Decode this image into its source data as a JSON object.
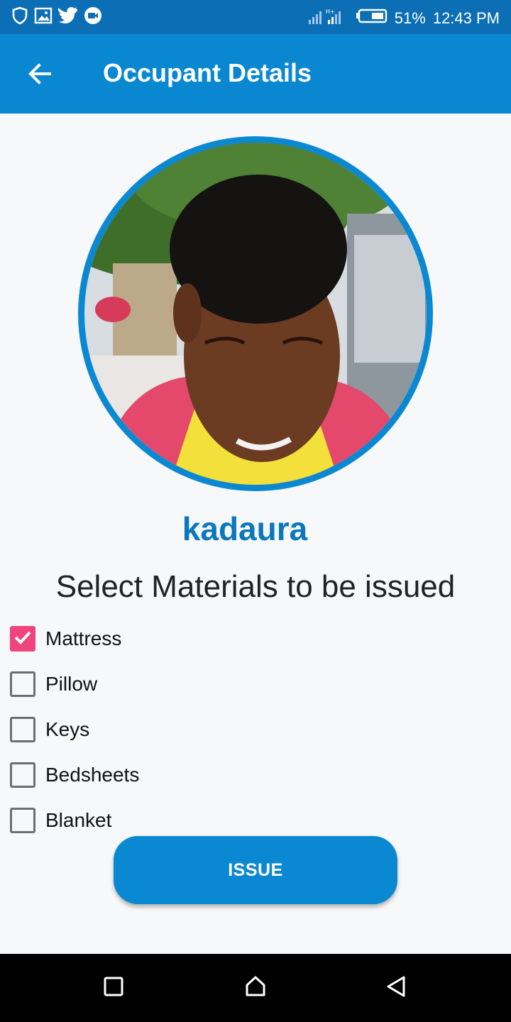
{
  "status_bar": {
    "left_icons": [
      "shield-icon",
      "image-icon",
      "twitter-icon",
      "video-call-icon"
    ],
    "battery_percent": "51%",
    "time": "12:43 PM"
  },
  "app_bar": {
    "title": "Occupant Details",
    "back_icon": "arrow-left-icon"
  },
  "occupant": {
    "name": "kadaura"
  },
  "materials": {
    "heading": "Select Materials to be issued",
    "items": [
      {
        "label": "Mattress",
        "checked": true
      },
      {
        "label": "Pillow",
        "checked": false
      },
      {
        "label": "Keys",
        "checked": false
      },
      {
        "label": "Bedsheets",
        "checked": false
      },
      {
        "label": "Blanket",
        "checked": false
      }
    ]
  },
  "actions": {
    "issue_label": "ISSUE"
  },
  "colors": {
    "status_bar": "#0c6eb5",
    "app_bar": "#0988d1",
    "accent": "#0a88d1",
    "checkbox_checked": "#f0447d",
    "name_text": "#0b78bd"
  },
  "nav_bar": {
    "buttons": [
      "recents-square-icon",
      "home-icon",
      "back-triangle-icon"
    ]
  }
}
